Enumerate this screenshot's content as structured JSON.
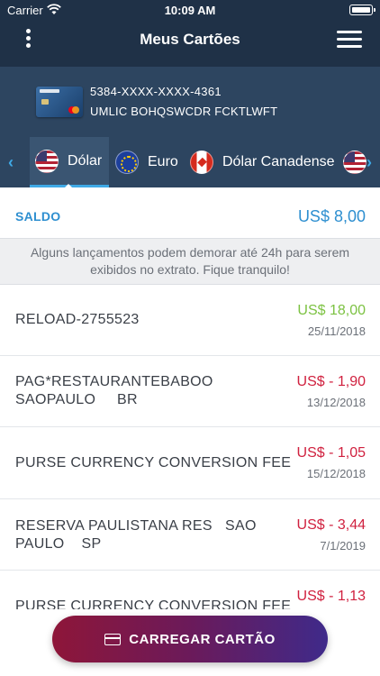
{
  "status_bar": {
    "carrier": "Carrier",
    "time": "10:09 AM"
  },
  "header": {
    "title": "Meus Cartões"
  },
  "card": {
    "number": "5384-XXXX-XXXX-4361",
    "holder": "UMLIC BOHQSWCDR FCKTLWFT"
  },
  "currency_tabs": [
    {
      "label": "Dólar",
      "flag": "us-flag-icon",
      "active": true
    },
    {
      "label": "Euro",
      "flag": "eu-flag-icon",
      "active": false
    },
    {
      "label": "Dólar Canadense",
      "flag": "canada-flag-icon",
      "active": false
    }
  ],
  "balance": {
    "label": "SALDO",
    "value": "US$  8,00"
  },
  "notice": "Alguns lançamentos podem demorar até 24h para serem exibidos no extrato. Fique tranquilo!",
  "transactions": [
    {
      "description": "RELOAD-2755523",
      "amount": "US$  18,00",
      "date": "25/11/2018",
      "type": "credit"
    },
    {
      "description": "PAG*RESTAURANTEBABOO\nSAOPAULO     BR",
      "amount": "US$ - 1,90",
      "date": "13/12/2018",
      "type": "debit"
    },
    {
      "description": "PURSE CURRENCY CONVERSION FEE",
      "amount": "US$ - 1,05",
      "date": "15/12/2018",
      "type": "debit"
    },
    {
      "description": "RESERVA PAULISTANA RES   SAO\nPAULO    SP",
      "amount": "US$ - 3,44",
      "date": "7/1/2019",
      "type": "debit"
    },
    {
      "description": "PURSE CURRENCY CONVERSION FEE",
      "amount": "US$ - 1,13",
      "date": "",
      "type": "debit"
    }
  ],
  "actions": {
    "load_card": "CARREGAR CARTÃO"
  },
  "colors": {
    "nav_bg": "#1f3147",
    "accent_blue": "#2e8fd0",
    "credit": "#7cc242",
    "debit": "#d0213f"
  }
}
